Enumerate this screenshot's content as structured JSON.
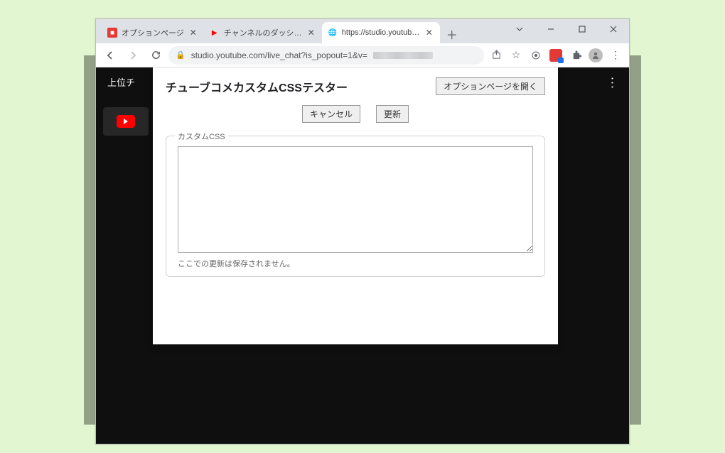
{
  "tabs": [
    {
      "title": "オプションページ",
      "favicon": "red"
    },
    {
      "title": "チャンネルのダッシュボード - YouT",
      "favicon": "yt"
    },
    {
      "title": "https://studio.youtube.com/",
      "favicon": "globe",
      "active": true
    }
  ],
  "url_visible": "studio.youtube.com/live_chat?is_popout=1&v=",
  "dark_header_text": "上位チ",
  "popup": {
    "title": "チューブコメカスタムCSSテスター",
    "open_options_label": "オプションページを開く",
    "cancel_label": "キャンセル",
    "update_label": "更新",
    "legend": "カスタムCSS",
    "note": "ここでの更新は保存されません。"
  }
}
